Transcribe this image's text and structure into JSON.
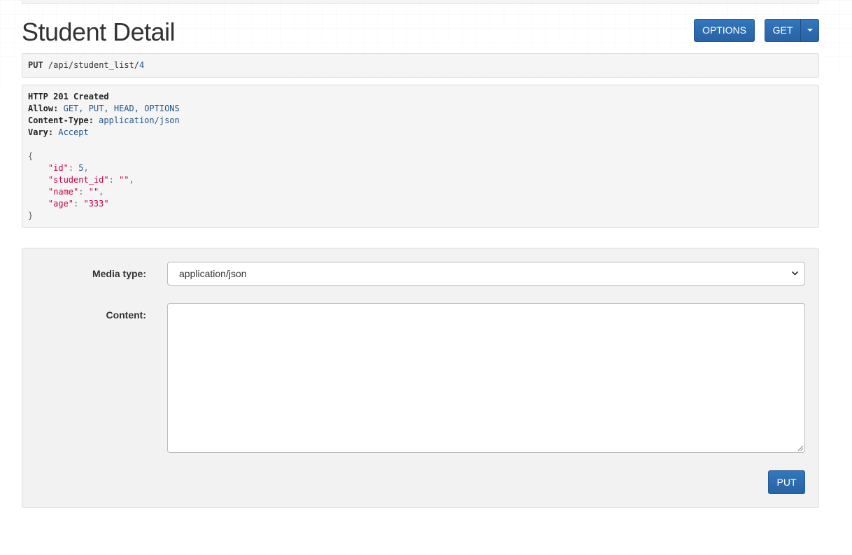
{
  "page": {
    "title": "Student Detail"
  },
  "toolbar": {
    "options_label": "OPTIONS",
    "get_label": "GET",
    "get_menu_icon": "caret-down-icon"
  },
  "request": {
    "method": "PUT",
    "path_segments": [
      "/",
      "api",
      "/",
      "student_list",
      "/",
      "4"
    ]
  },
  "response": {
    "status": "HTTP 201 Created",
    "headers": [
      {
        "key": "Allow:",
        "value": "GET, PUT, HEAD, OPTIONS"
      },
      {
        "key": "Content-Type:",
        "value": "application/json"
      },
      {
        "key": "Vary:",
        "value": "Accept"
      }
    ],
    "body": {
      "open": "{",
      "close": "}",
      "fields": [
        {
          "key": "\"id\"",
          "value": "5",
          "type": "number"
        },
        {
          "key": "\"student_id\"",
          "value": "\"\"",
          "type": "string"
        },
        {
          "key": "\"name\"",
          "value": "\"\"",
          "type": "string"
        },
        {
          "key": "\"age\"",
          "value": "\"333\"",
          "type": "string"
        }
      ]
    }
  },
  "form": {
    "media_type_label": "Media type:",
    "media_type_value": "application/json",
    "content_label": "Content:",
    "content_value": "",
    "submit_label": "PUT"
  },
  "colors": {
    "primary_button": "#2c6cb0",
    "link_blue": "#225588",
    "json_key": "#cc0044"
  }
}
